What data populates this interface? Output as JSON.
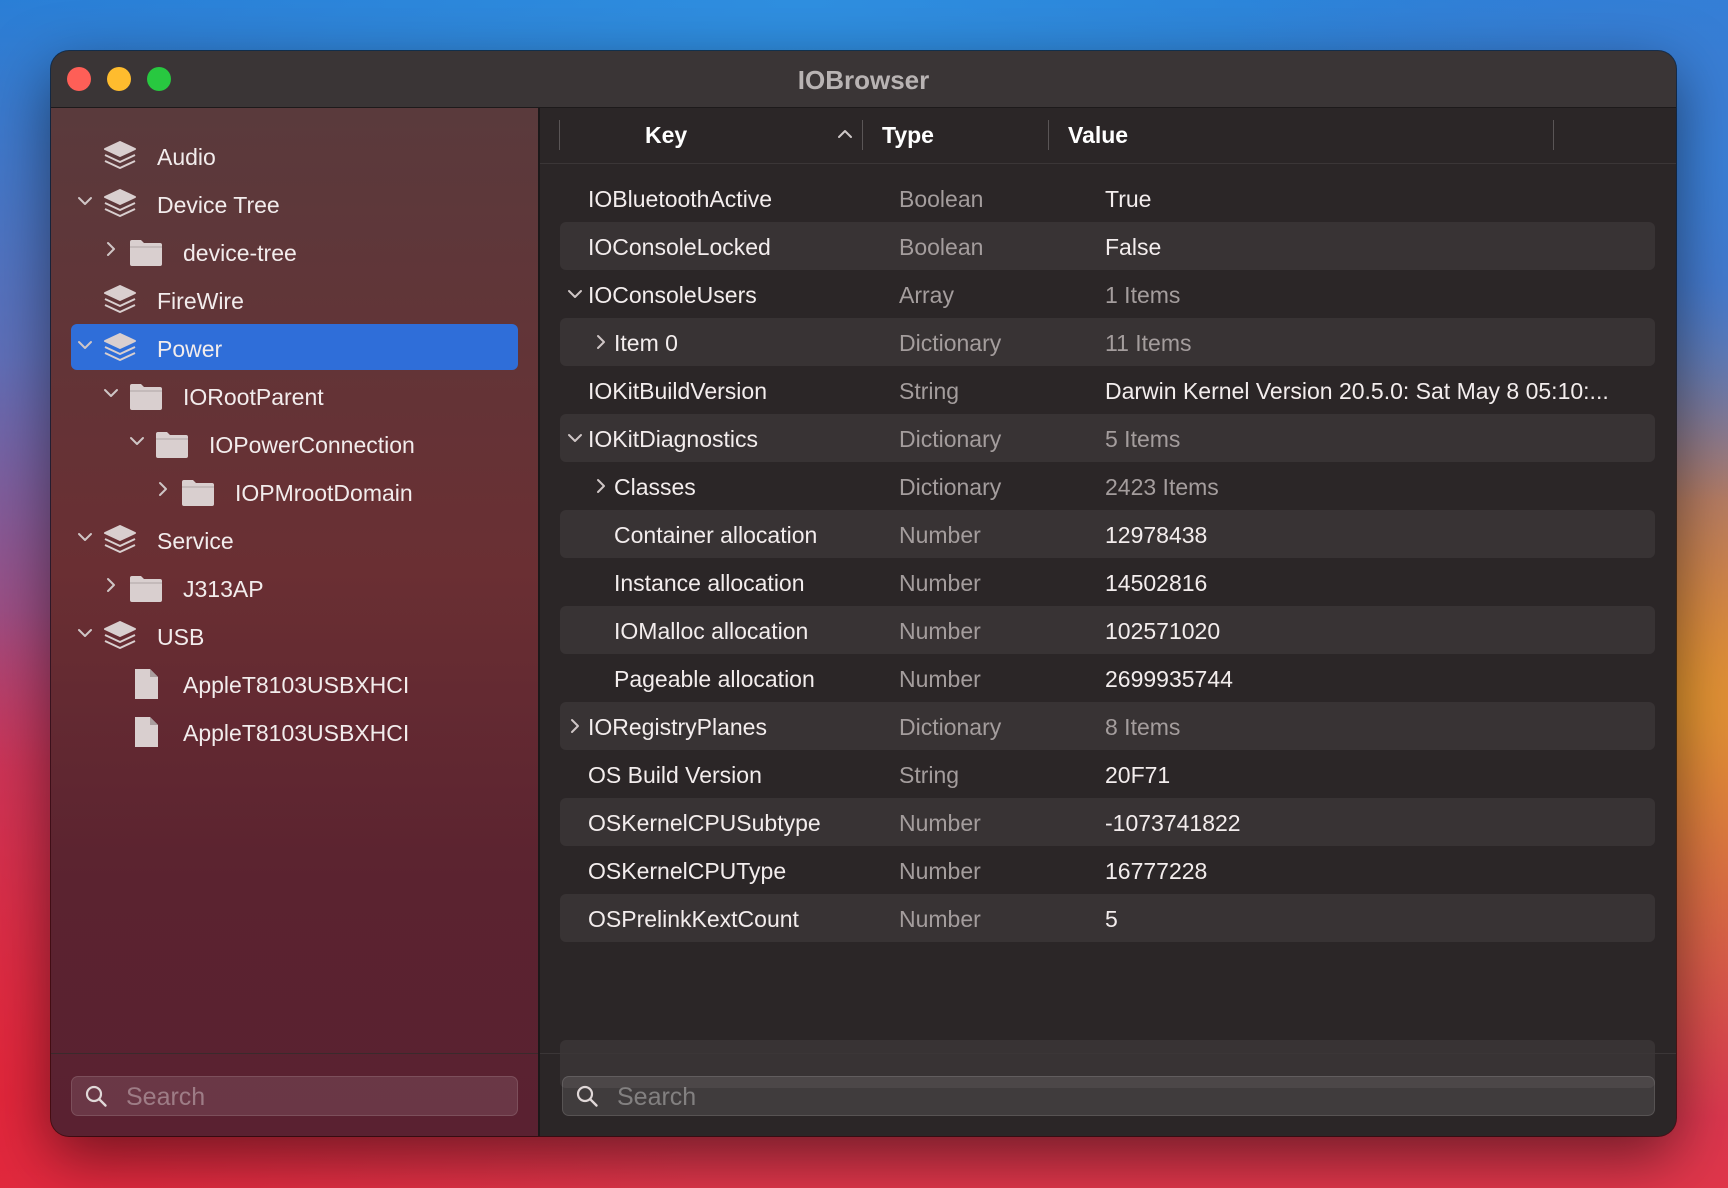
{
  "window": {
    "title": "IOBrowser"
  },
  "sidebar": {
    "items": [
      {
        "label": "Audio",
        "level": 0,
        "icon": "stack-icon",
        "chevron": "none",
        "selected": false
      },
      {
        "label": "Device Tree",
        "level": 0,
        "icon": "stack-icon",
        "chevron": "down",
        "selected": false
      },
      {
        "label": "device-tree",
        "level": 1,
        "icon": "folder-icon",
        "chevron": "right",
        "selected": false
      },
      {
        "label": "FireWire",
        "level": 0,
        "icon": "stack-icon",
        "chevron": "none",
        "selected": false
      },
      {
        "label": "Power",
        "level": 0,
        "icon": "stack-icon",
        "chevron": "down",
        "selected": true
      },
      {
        "label": "IORootParent",
        "level": 1,
        "icon": "folder-icon",
        "chevron": "down",
        "selected": false
      },
      {
        "label": "IOPowerConnection",
        "level": 2,
        "icon": "folder-icon",
        "chevron": "down",
        "selected": false
      },
      {
        "label": "IOPMrootDomain",
        "level": 3,
        "icon": "folder-icon",
        "chevron": "right",
        "selected": false
      },
      {
        "label": "Service",
        "level": 0,
        "icon": "stack-icon",
        "chevron": "down",
        "selected": false
      },
      {
        "label": "J313AP",
        "level": 1,
        "icon": "folder-icon",
        "chevron": "right",
        "selected": false
      },
      {
        "label": "USB",
        "level": 0,
        "icon": "stack-icon",
        "chevron": "down",
        "selected": false
      },
      {
        "label": "AppleT8103USBXHCI",
        "level": 1,
        "icon": "document-icon",
        "chevron": "none",
        "selected": false
      },
      {
        "label": "AppleT8103USBXHCI",
        "level": 1,
        "icon": "document-icon",
        "chevron": "none",
        "selected": false
      }
    ],
    "search": {
      "placeholder": "Search"
    }
  },
  "table": {
    "columns": {
      "key": "Key",
      "type": "Type",
      "value": "Value"
    },
    "sort": "ascending",
    "rows": [
      {
        "key": "IOBluetoothActive",
        "type": "Boolean",
        "value": "True",
        "level": 0,
        "chevron": "none",
        "dim": false
      },
      {
        "key": "IOConsoleLocked",
        "type": "Boolean",
        "value": "False",
        "level": 0,
        "chevron": "none",
        "dim": false
      },
      {
        "key": "IOConsoleUsers",
        "type": "Array",
        "value": "1 Items",
        "level": 0,
        "chevron": "down",
        "dim": true
      },
      {
        "key": "Item 0",
        "type": "Dictionary",
        "value": "11 Items",
        "level": 1,
        "chevron": "right",
        "dim": true
      },
      {
        "key": "IOKitBuildVersion",
        "type": "String",
        "value": "Darwin Kernel Version 20.5.0: Sat May  8 05:10:...",
        "level": 0,
        "chevron": "none",
        "dim": false
      },
      {
        "key": "IOKitDiagnostics",
        "type": "Dictionary",
        "value": "5 Items",
        "level": 0,
        "chevron": "down",
        "dim": true
      },
      {
        "key": "Classes",
        "type": "Dictionary",
        "value": "2423 Items",
        "level": 1,
        "chevron": "right",
        "dim": true
      },
      {
        "key": "Container allocation",
        "type": "Number",
        "value": "12978438",
        "level": 1,
        "chevron": "none",
        "dim": false
      },
      {
        "key": "Instance allocation",
        "type": "Number",
        "value": "14502816",
        "level": 1,
        "chevron": "none",
        "dim": false
      },
      {
        "key": "IOMalloc allocation",
        "type": "Number",
        "value": "102571020",
        "level": 1,
        "chevron": "none",
        "dim": false
      },
      {
        "key": "Pageable allocation",
        "type": "Number",
        "value": "2699935744",
        "level": 1,
        "chevron": "none",
        "dim": false
      },
      {
        "key": "IORegistryPlanes",
        "type": "Dictionary",
        "value": "8 Items",
        "level": 0,
        "chevron": "right",
        "dim": true
      },
      {
        "key": "OS Build Version",
        "type": "String",
        "value": "20F71",
        "level": 0,
        "chevron": "none",
        "dim": false
      },
      {
        "key": "OSKernelCPUSubtype",
        "type": "Number",
        "value": "-1073741822",
        "level": 0,
        "chevron": "none",
        "dim": false
      },
      {
        "key": "OSKernelCPUType",
        "type": "Number",
        "value": "16777228",
        "level": 0,
        "chevron": "none",
        "dim": false
      },
      {
        "key": "OSPrelinkKextCount",
        "type": "Number",
        "value": "5",
        "level": 0,
        "chevron": "none",
        "dim": false
      }
    ],
    "search": {
      "placeholder": "Search"
    }
  },
  "colors": {
    "selection": "#2f6ed9",
    "close": "#fe5f57",
    "minimize": "#febc2e",
    "zoom": "#28c840"
  }
}
